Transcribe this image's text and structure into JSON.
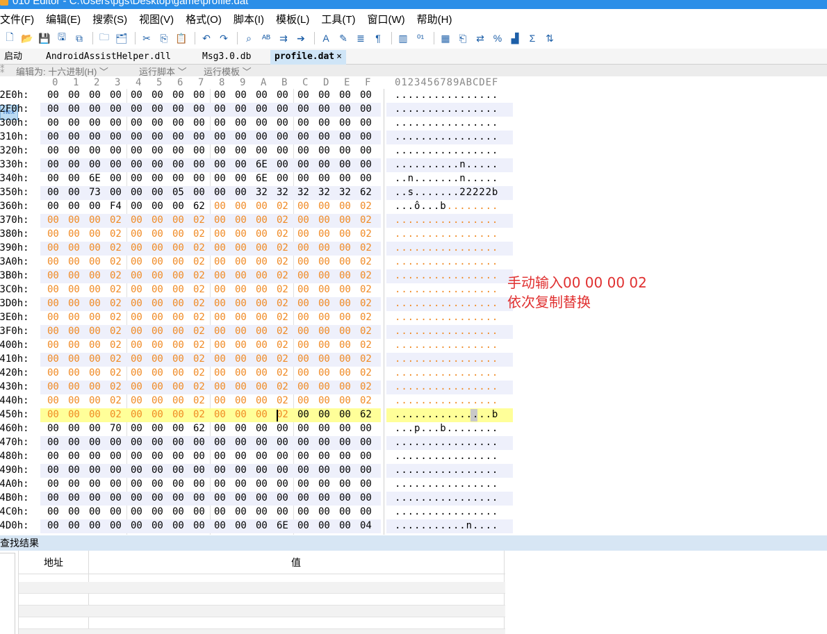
{
  "window": {
    "title": "010 Editor - C:\\Users\\pgs\\Desktop\\game\\profile.dat"
  },
  "menu": [
    "文件(F)",
    "编辑(E)",
    "搜索(S)",
    "视图(V)",
    "格式(O)",
    "脚本(I)",
    "模板(L)",
    "工具(T)",
    "窗口(W)",
    "帮助(H)"
  ],
  "toolbar": {
    "icons": [
      "new-file-icon",
      "open-folder-icon",
      "save-icon",
      "save-as-icon",
      "save-all-icon",
      "folder-icon",
      "open-multiple-icon",
      "cut-icon",
      "copy-icon",
      "paste-icon",
      "undo-icon",
      "redo-icon",
      "find-icon",
      "replace-icon",
      "find-in-files-icon",
      "goto-icon",
      "font-icon",
      "edit-as-icon",
      "hex-mode-icon",
      "text-mode-icon",
      "paragraph-icon",
      "columns-icon",
      "binary-icon",
      "calculator-icon",
      "compare-icon",
      "swap-icon",
      "percent-icon",
      "histogram-icon",
      "checksum-icon",
      "base-converter-icon"
    ],
    "hex_label": "Hex"
  },
  "tabs": {
    "items": [
      {
        "label": "启动"
      },
      {
        "label": "AndroidAssistHelper.dll"
      },
      {
        "label": "Msg3.0.db"
      },
      {
        "label": "profile.dat",
        "active": true,
        "close": "×"
      }
    ]
  },
  "subbar": {
    "edit_as": "编辑为: 十六进制(H) ﹀",
    "run_script": "运行脚本 ﹀",
    "run_template": "运行模板 ﹀"
  },
  "hex": {
    "columns": [
      "0",
      "1",
      "2",
      "3",
      "4",
      "5",
      "6",
      "7",
      "8",
      "9",
      "A",
      "B",
      "C",
      "D",
      "E",
      "F"
    ],
    "ascii_header": "0123456789ABCDEF",
    "rows": [
      {
        "addr": "02E0h:",
        "bytes": "00 00 00 00 00 00 00 00 00 00 00 00 00 00 00 00",
        "ascii": "................",
        "mod_from": 16
      },
      {
        "addr": "02F0h:",
        "bytes": "00 00 00 00 00 00 00 00 00 00 00 00 00 00 00 00",
        "ascii": "................",
        "mod_from": 16
      },
      {
        "addr": "0300h:",
        "bytes": "00 00 00 00 00 00 00 00 00 00 00 00 00 00 00 00",
        "ascii": "................",
        "mod_from": 16
      },
      {
        "addr": "0310h:",
        "bytes": "00 00 00 00 00 00 00 00 00 00 00 00 00 00 00 00",
        "ascii": "................",
        "mod_from": 16
      },
      {
        "addr": "0320h:",
        "bytes": "00 00 00 00 00 00 00 00 00 00 00 00 00 00 00 00",
        "ascii": "................",
        "mod_from": 16
      },
      {
        "addr": "0330h:",
        "bytes": "00 00 00 00 00 00 00 00 00 00 6E 00 00 00 00 00",
        "ascii": "..........n.....",
        "mod_from": 16
      },
      {
        "addr": "0340h:",
        "bytes": "00 00 6E 00 00 00 00 00 00 00 6E 00 00 00 00 00",
        "ascii": "..n.......n.....",
        "mod_from": 16
      },
      {
        "addr": "0350h:",
        "bytes": "00 00 73 00 00 00 05 00 00 00 32 32 32 32 32 62",
        "ascii": "..s.......22222b",
        "mod_from": 16
      },
      {
        "addr": "0360h:",
        "bytes": "00 00 00 F4 00 00 00 62 00 00 00 02 00 00 00 02",
        "ascii": "...ô...b........",
        "mod_from": 8
      },
      {
        "addr": "0370h:",
        "bytes": "00 00 00 02 00 00 00 02 00 00 00 02 00 00 00 02",
        "ascii": "................",
        "mod_from": 0
      },
      {
        "addr": "0380h:",
        "bytes": "00 00 00 02 00 00 00 02 00 00 00 02 00 00 00 02",
        "ascii": "................",
        "mod_from": 0
      },
      {
        "addr": "0390h:",
        "bytes": "00 00 00 02 00 00 00 02 00 00 00 02 00 00 00 02",
        "ascii": "................",
        "mod_from": 0
      },
      {
        "addr": "03A0h:",
        "bytes": "00 00 00 02 00 00 00 02 00 00 00 02 00 00 00 02",
        "ascii": "................",
        "mod_from": 0
      },
      {
        "addr": "03B0h:",
        "bytes": "00 00 00 02 00 00 00 02 00 00 00 02 00 00 00 02",
        "ascii": "................",
        "mod_from": 0
      },
      {
        "addr": "03C0h:",
        "bytes": "00 00 00 02 00 00 00 02 00 00 00 02 00 00 00 02",
        "ascii": "................",
        "mod_from": 0
      },
      {
        "addr": "03D0h:",
        "bytes": "00 00 00 02 00 00 00 02 00 00 00 02 00 00 00 02",
        "ascii": "................",
        "mod_from": 0
      },
      {
        "addr": "03E0h:",
        "bytes": "00 00 00 02 00 00 00 02 00 00 00 02 00 00 00 02",
        "ascii": "................",
        "mod_from": 0
      },
      {
        "addr": "03F0h:",
        "bytes": "00 00 00 02 00 00 00 02 00 00 00 02 00 00 00 02",
        "ascii": "................",
        "mod_from": 0
      },
      {
        "addr": "0400h:",
        "bytes": "00 00 00 02 00 00 00 02 00 00 00 02 00 00 00 02",
        "ascii": "................",
        "mod_from": 0
      },
      {
        "addr": "0410h:",
        "bytes": "00 00 00 02 00 00 00 02 00 00 00 02 00 00 00 02",
        "ascii": "................",
        "mod_from": 0
      },
      {
        "addr": "0420h:",
        "bytes": "00 00 00 02 00 00 00 02 00 00 00 02 00 00 00 02",
        "ascii": "................",
        "mod_from": 0
      },
      {
        "addr": "0430h:",
        "bytes": "00 00 00 02 00 00 00 02 00 00 00 02 00 00 00 02",
        "ascii": "................",
        "mod_from": 0
      },
      {
        "addr": "0440h:",
        "bytes": "00 00 00 02 00 00 00 02 00 00 00 02 00 00 00 02",
        "ascii": "................",
        "mod_from": 0
      },
      {
        "addr": "0450h:",
        "bytes": "00 00 00 02 00 00 00 02 00 00 00 02 00 00 00 62",
        "ascii": "...............b",
        "mod_from": 0,
        "mod_to": 12,
        "highlight": true
      },
      {
        "addr": "0460h:",
        "bytes": "00 00 00 70 00 00 00 62 00 00 00 00 00 00 00 00",
        "ascii": "...p...b........",
        "mod_from": 16
      },
      {
        "addr": "0470h:",
        "bytes": "00 00 00 00 00 00 00 00 00 00 00 00 00 00 00 00",
        "ascii": "................",
        "mod_from": 16
      },
      {
        "addr": "0480h:",
        "bytes": "00 00 00 00 00 00 00 00 00 00 00 00 00 00 00 00",
        "ascii": "................",
        "mod_from": 16
      },
      {
        "addr": "0490h:",
        "bytes": "00 00 00 00 00 00 00 00 00 00 00 00 00 00 00 00",
        "ascii": "................",
        "mod_from": 16
      },
      {
        "addr": "04A0h:",
        "bytes": "00 00 00 00 00 00 00 00 00 00 00 00 00 00 00 00",
        "ascii": "................",
        "mod_from": 16
      },
      {
        "addr": "04B0h:",
        "bytes": "00 00 00 00 00 00 00 00 00 00 00 00 00 00 00 00",
        "ascii": "................",
        "mod_from": 16
      },
      {
        "addr": "04C0h:",
        "bytes": "00 00 00 00 00 00 00 00 00 00 00 00 00 00 00 00",
        "ascii": "................",
        "mod_from": 16
      },
      {
        "addr": "04D0h:",
        "bytes": "00 00 00 00 00 00 00 00 00 00 00 6E 00 00 00 04",
        "ascii": "...........n....",
        "mod_from": 16
      }
    ]
  },
  "annotation": {
    "line1": "手动输入00 00 00 02",
    "line2": "依次复制替换"
  },
  "results": {
    "title": "查找结果",
    "col_address": "地址",
    "col_value": "值"
  },
  "colors": {
    "modified_byte": "#f08a24",
    "row_highlight": "#ffff99",
    "annotation": "#e03030",
    "title_bar": "#2b8ee8"
  }
}
